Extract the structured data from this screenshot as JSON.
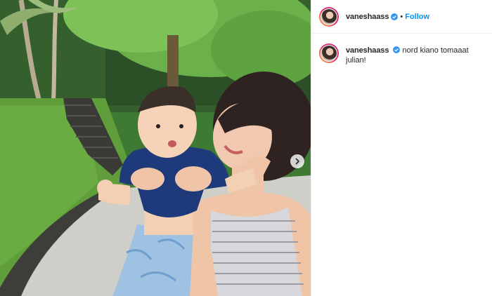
{
  "post": {
    "author": {
      "username": "vaneshaass",
      "verified": true,
      "follow_label": "Follow",
      "separator": "•"
    },
    "caption": {
      "username": "vaneshaass",
      "text": "nord kiano tomaaat julian!"
    },
    "media": {
      "carousel_next_icon": "chevron-right-icon"
    }
  },
  "colors": {
    "follow_blue": "#0095f6",
    "verified_blue": "#3897f0",
    "text": "#262626",
    "divider": "#efefef"
  }
}
